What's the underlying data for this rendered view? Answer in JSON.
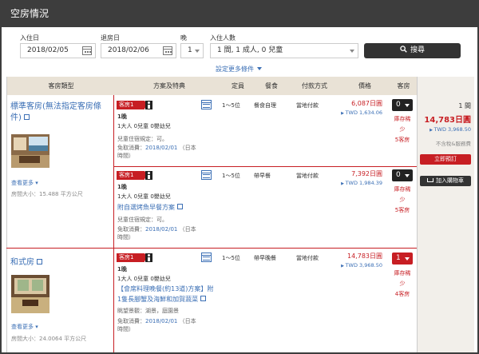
{
  "header": {
    "title": "空房情況"
  },
  "search": {
    "checkin_label": "入住日",
    "checkin_value": "2018/02/05",
    "checkout_label": "退房日",
    "checkout_value": "2018/02/06",
    "nights_label": "晚",
    "nights_value": "1",
    "guests_label": "入住人數",
    "guests_value": "1 間, 1 成人, 0 兒童",
    "search_button": "搜尋",
    "more_conditions": "設定更多條件"
  },
  "table": {
    "headers": [
      "客房類型",
      "方案及特典",
      "定員",
      "餐食",
      "付款方式",
      "價格",
      "客房"
    ]
  },
  "rooms": [
    {
      "name": "標準客房(無法指定客房條件)",
      "see_more": "查看更多",
      "size": "房間大小：15.488 平方公尺",
      "plans": [
        {
          "badge": "客房1",
          "nights": "1晚",
          "guests": "1大人 0兒童 0嬰幼兒",
          "child_policy": "兒童住宿規定：可。",
          "free_cancel": "免取消費：",
          "free_cancel_date": "2018/02/01",
          "free_cancel_tz": "（日本時間）",
          "capacity": "1～5位",
          "meal": "餐食自理",
          "payment": "當地付款",
          "price": "6,087日圓",
          "twd": "TWD 1,634.06",
          "qty": "0",
          "rare1": "庫存稀",
          "rare2": "少",
          "rare3": "5客房"
        },
        {
          "badge": "客房1",
          "nights": "1晚",
          "guests": "1大人 0兒童 0嬰幼兒",
          "plan_link": "附自選烤魚早餐方案",
          "child_policy": "兒童住宿規定：可。",
          "free_cancel": "免取消費：",
          "free_cancel_date": "2018/02/01",
          "free_cancel_tz": "（日本時間）",
          "capacity": "1～5位",
          "meal": "帶早餐",
          "payment": "當地付款",
          "price": "7,392日圓",
          "twd": "TWD 1,984.39",
          "qty": "0",
          "rare1": "庫存稀",
          "rare2": "少",
          "rare3": "5客房"
        }
      ]
    },
    {
      "name": "和式房",
      "see_more": "查看更多",
      "size": "房間大小：24.0064 平方公尺",
      "plans": [
        {
          "badge": "客房1",
          "nights": "1晚",
          "guests": "1大人 0兒童 0嬰幼兒",
          "plan_link1": "【會席料理晚餐(約13道)方案】附",
          "plan_link2": "1隻長腳蟹及海鮮和加賀蔬菜",
          "view": "眺望景觀：湖景，庭園景",
          "free_cancel": "免取消費：",
          "free_cancel_date": "2018/02/01",
          "free_cancel_tz": "（日本時間）",
          "capacity": "1～5位",
          "meal": "帶早晚餐",
          "payment": "當地付款",
          "price": "14,783日圓",
          "twd": "TWD 3,968.50",
          "qty": "1",
          "rare1": "庫存稀",
          "rare2": "少",
          "rare3": "4客房"
        }
      ]
    }
  ],
  "sidebar": {
    "rooms_count": "1 間",
    "total_price": "14,783日圓",
    "total_twd": "TWD 3,968.50",
    "tax_note": "不含稅&服務費",
    "book_button": "立即預訂",
    "cart_button": "加入購物車"
  },
  "colors": {
    "header": "#3d3d3d",
    "accent_red": "#c71e23",
    "link_blue": "#3b6fb5",
    "table_header": "#e9e2d6"
  }
}
